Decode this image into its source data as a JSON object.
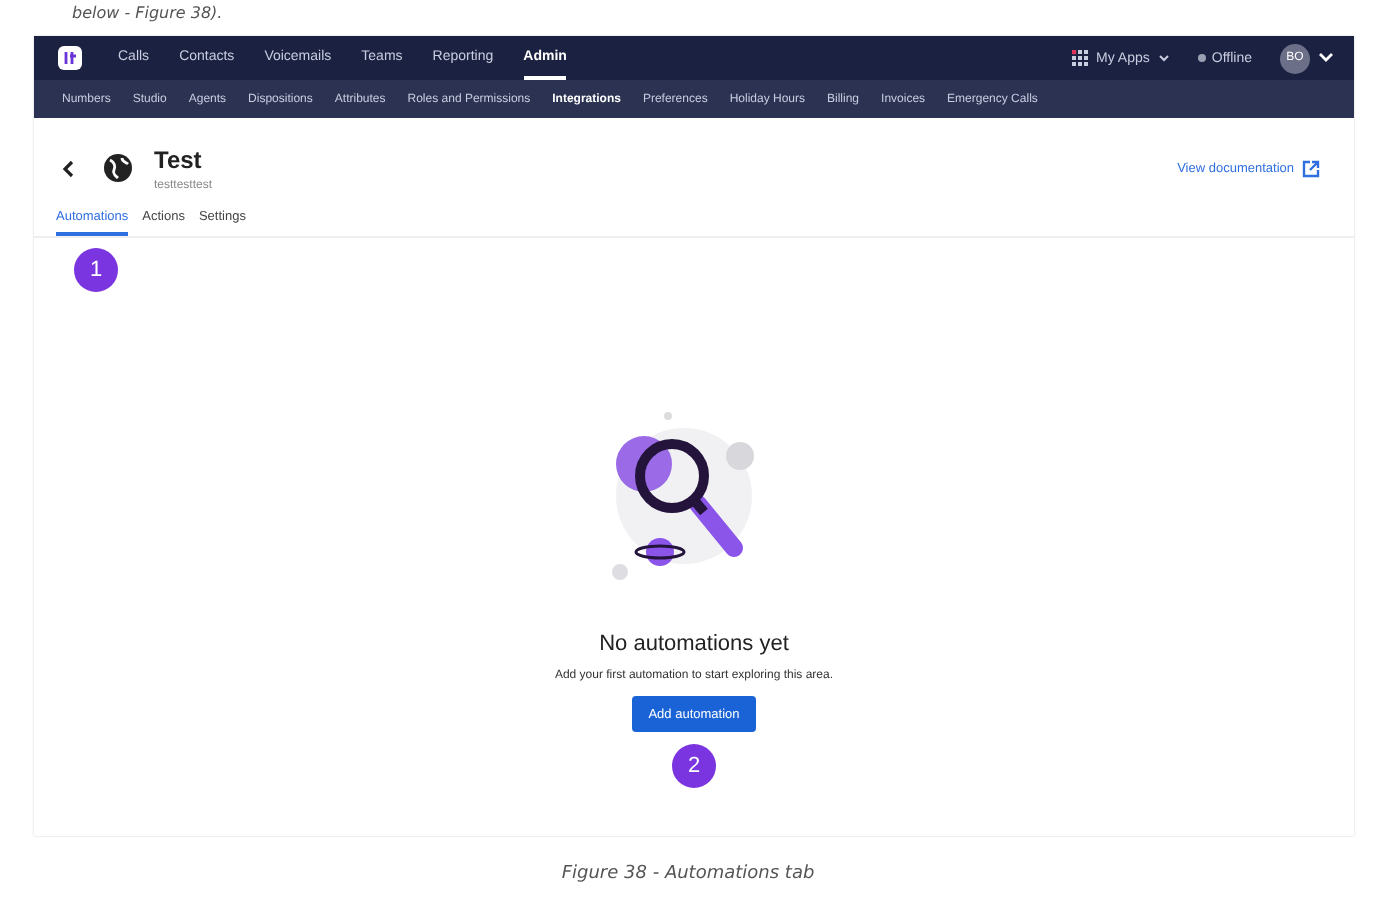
{
  "intro_text": "below - Figure 38).",
  "top_nav": {
    "items": [
      {
        "label": "Calls",
        "selected": false
      },
      {
        "label": "Contacts",
        "selected": false
      },
      {
        "label": "Voicemails",
        "selected": false
      },
      {
        "label": "Teams",
        "selected": false
      },
      {
        "label": "Reporting",
        "selected": false
      },
      {
        "label": "Admin",
        "selected": true
      }
    ],
    "apps": "My Apps",
    "status": "Offline",
    "avatar": "BO"
  },
  "sub_nav": [
    {
      "label": "Numbers",
      "selected": false
    },
    {
      "label": "Studio",
      "selected": false
    },
    {
      "label": "Agents",
      "selected": false
    },
    {
      "label": "Dispositions",
      "selected": false
    },
    {
      "label": "Attributes",
      "selected": false
    },
    {
      "label": "Roles and Permissions",
      "selected": false
    },
    {
      "label": "Integrations",
      "selected": true
    },
    {
      "label": "Preferences",
      "selected": false
    },
    {
      "label": "Holiday Hours",
      "selected": false
    },
    {
      "label": "Billing",
      "selected": false
    },
    {
      "label": "Invoices",
      "selected": false
    },
    {
      "label": "Emergency Calls",
      "selected": false
    }
  ],
  "header": {
    "title": "Test",
    "subtitle": "testtesttest",
    "doc_link": "View documentation"
  },
  "tabs": [
    {
      "label": "Automations",
      "selected": true
    },
    {
      "label": "Actions",
      "selected": false
    },
    {
      "label": "Settings",
      "selected": false
    }
  ],
  "callouts": [
    "1",
    "2"
  ],
  "empty_state": {
    "title": "No automations yet",
    "text": "Add your first automation to start exploring this area.",
    "button": "Add automation"
  },
  "caption": "Figure 38 - Automations tab"
}
